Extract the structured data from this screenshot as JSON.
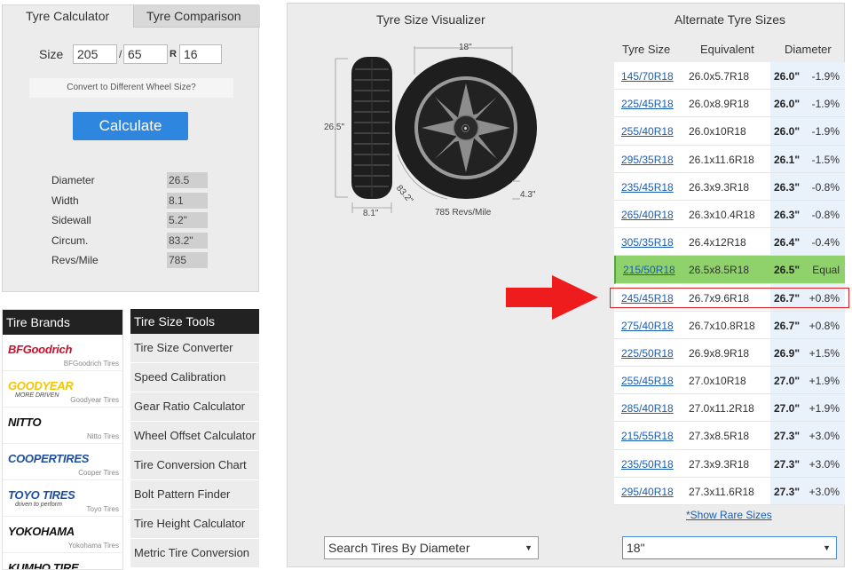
{
  "calculator": {
    "tabs": [
      "Tyre Calculator",
      "Tyre Comparison"
    ],
    "size_label": "Size",
    "width": "205",
    "aspect": "65",
    "r_label": "R",
    "rim": "16",
    "slash": "/",
    "convert_text": "Convert to Different Wheel Size?",
    "button": "Calculate",
    "stats": [
      {
        "label": "Diameter",
        "value": "26.5"
      },
      {
        "label": "Width",
        "value": "8.1"
      },
      {
        "label": "Sidewall",
        "value": "5.2\""
      },
      {
        "label": "Circum.",
        "value": "83.2\""
      },
      {
        "label": "Revs/Mile",
        "value": "785"
      }
    ]
  },
  "brands": {
    "title": "Tire Brands",
    "items": [
      {
        "logo": "BFGoodrich",
        "sub": "BFGoodrich Tires",
        "color": "#c8102e"
      },
      {
        "logo": "GOODYEAR",
        "tag": "MORE DRIVEN",
        "sub": "Goodyear Tires",
        "color": "#f2c500"
      },
      {
        "logo": "NITTO",
        "sub": "Nitto Tires",
        "color": "#111111"
      },
      {
        "logo": "COOPERTIRES",
        "sub": "Cooper Tires",
        "color": "#1f4f9a"
      },
      {
        "logo": "TOYO TIRES",
        "tag": "driven to perform",
        "sub": "Toyo Tires",
        "color": "#1c4fa3"
      },
      {
        "logo": "YOKOHAMA",
        "sub": "Yokohama Tires",
        "color": "#111111"
      },
      {
        "logo": "KUMHO TIRE",
        "sub": "",
        "color": "#111111"
      }
    ]
  },
  "tools": {
    "title": "Tire Size Tools",
    "items": [
      "Tire Size Converter",
      "Speed Calibration",
      "Gear Ratio Calculator",
      "Wheel Offset Calculator",
      "Tire Conversion Chart",
      "Bolt Pattern Finder",
      "Tire Height Calculator",
      "Metric Tire Conversion"
    ]
  },
  "visualizer": {
    "title": "Tyre Size Visualizer",
    "rim_label": "18\"",
    "height_label": "26.5\"",
    "width_label": "8.1\"",
    "circ_label": "83.2\"",
    "sidewall_label": "4.3\"",
    "revs_label": "785 Revs/Mile"
  },
  "alternates": {
    "title": "Alternate Tyre Sizes",
    "headers": [
      "Tyre Size",
      "Equivalent",
      "Diameter"
    ],
    "rows": [
      {
        "size": "145/70R18",
        "equiv": "26.0x5.7R18",
        "dia": "26.0\"",
        "pct": "-1.9%"
      },
      {
        "size": "225/45R18",
        "equiv": "26.0x8.9R18",
        "dia": "26.0\"",
        "pct": "-1.9%"
      },
      {
        "size": "255/40R18",
        "equiv": "26.0x10R18",
        "dia": "26.0\"",
        "pct": "-1.9%"
      },
      {
        "size": "295/35R18",
        "equiv": "26.1x11.6R18",
        "dia": "26.1\"",
        "pct": "-1.5%"
      },
      {
        "size": "235/45R18",
        "equiv": "26.3x9.3R18",
        "dia": "26.3\"",
        "pct": "-0.8%"
      },
      {
        "size": "265/40R18",
        "equiv": "26.3x10.4R18",
        "dia": "26.3\"",
        "pct": "-0.8%"
      },
      {
        "size": "305/35R18",
        "equiv": "26.4x12R18",
        "dia": "26.4\"",
        "pct": "-0.4%"
      },
      {
        "size": "215/50R18",
        "equiv": "26.5x8.5R18",
        "dia": "26.5\"",
        "pct": "Equal"
      },
      {
        "size": "245/45R18",
        "equiv": "26.7x9.6R18",
        "dia": "26.7\"",
        "pct": "+0.8%"
      },
      {
        "size": "275/40R18",
        "equiv": "26.7x10.8R18",
        "dia": "26.7\"",
        "pct": "+0.8%"
      },
      {
        "size": "225/50R18",
        "equiv": "26.9x8.9R18",
        "dia": "26.9\"",
        "pct": "+1.5%"
      },
      {
        "size": "255/45R18",
        "equiv": "27.0x10R18",
        "dia": "27.0\"",
        "pct": "+1.9%"
      },
      {
        "size": "285/40R18",
        "equiv": "27.0x11.2R18",
        "dia": "27.0\"",
        "pct": "+1.9%"
      },
      {
        "size": "215/55R18",
        "equiv": "27.3x8.5R18",
        "dia": "27.3\"",
        "pct": "+3.0%"
      },
      {
        "size": "235/50R18",
        "equiv": "27.3x9.3R18",
        "dia": "27.3\"",
        "pct": "+3.0%"
      },
      {
        "size": "295/40R18",
        "equiv": "27.3x11.6R18",
        "dia": "27.3\"",
        "pct": "+3.0%"
      }
    ],
    "rare_link": "*Show Rare Sizes"
  },
  "filters": {
    "diameter_select": "Search Tires By Diameter",
    "rim_select": "18\""
  },
  "colors": {
    "accent": "#2e86de",
    "equal_row": "#8fd16a",
    "highlight": "#e02020"
  }
}
